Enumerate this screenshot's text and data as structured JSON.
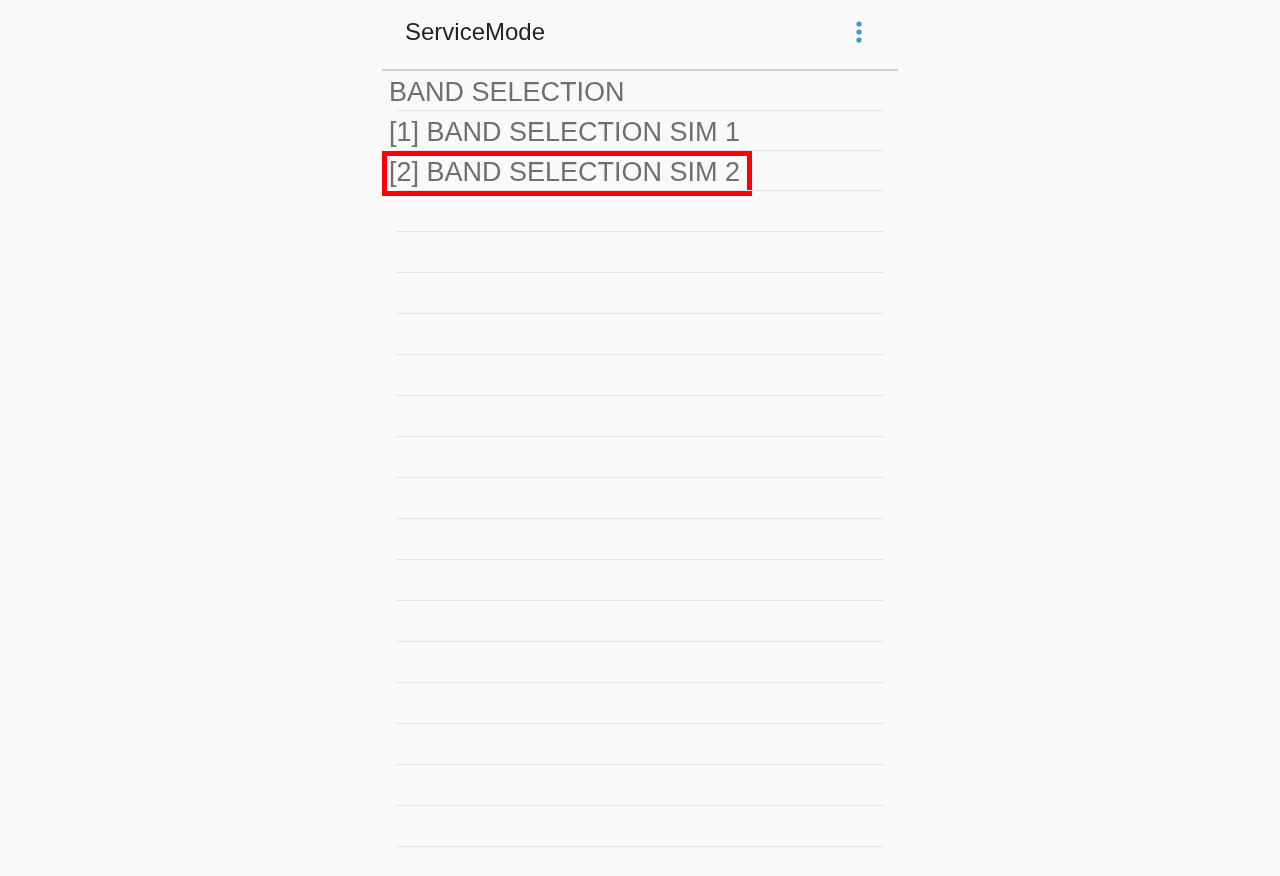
{
  "app_bar": {
    "title": "ServiceMode"
  },
  "items": [
    {
      "label": "BAND SELECTION",
      "highlighted": false
    },
    {
      "label": "[1] BAND SELECTION SIM 1",
      "highlighted": false
    },
    {
      "label": "[2] BAND SELECTION SIM 2",
      "highlighted": true
    }
  ]
}
